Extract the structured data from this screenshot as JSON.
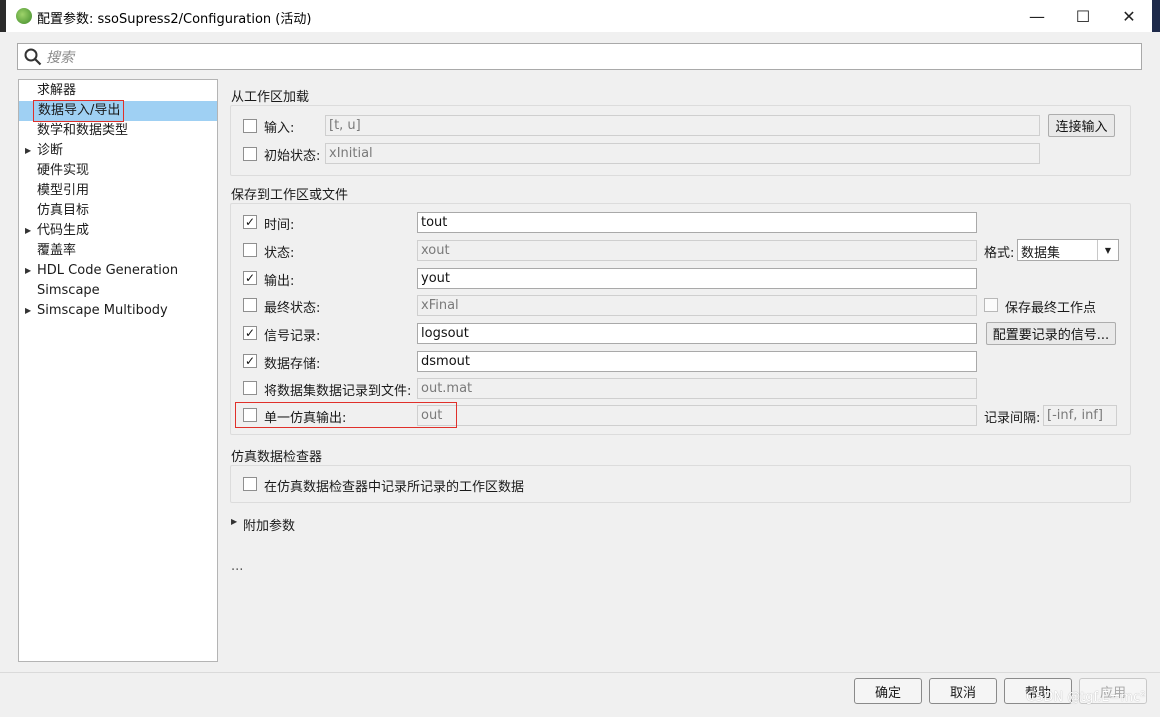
{
  "window": {
    "title": "配置参数: ssoSupress2/Configuration (活动)",
    "minimize_glyph": "—",
    "maximize_glyph": "☐",
    "close_glyph": "✕",
    "app_icon": "simulink-gear-icon"
  },
  "search": {
    "placeholder": "搜索",
    "icon": "search-icon"
  },
  "tree": {
    "items": [
      {
        "label": "求解器",
        "expandable": false
      },
      {
        "label": "数据导入/导出",
        "expandable": false,
        "selected": true
      },
      {
        "label": "数学和数据类型",
        "expandable": false
      },
      {
        "label": "诊断",
        "expandable": true
      },
      {
        "label": "硬件实现",
        "expandable": false
      },
      {
        "label": "模型引用",
        "expandable": false
      },
      {
        "label": "仿真目标",
        "expandable": false
      },
      {
        "label": "代码生成",
        "expandable": true
      },
      {
        "label": "覆盖率",
        "expandable": false
      },
      {
        "label": "HDL Code Generation",
        "expandable": true
      },
      {
        "label": "Simscape",
        "expandable": false
      },
      {
        "label": "Simscape Multibody",
        "expandable": true
      }
    ]
  },
  "load_section": {
    "title": "从工作区加载",
    "input": {
      "checked": false,
      "label": "输入:",
      "value": "[t, u]",
      "button": "连接输入"
    },
    "initial_state": {
      "checked": false,
      "label": "初始状态:",
      "value": "xInitial"
    }
  },
  "save_section": {
    "title": "保存到工作区或文件",
    "rows": [
      {
        "checked": true,
        "label": "时间:",
        "value": "tout",
        "enabled": true
      },
      {
        "checked": false,
        "label": "状态:",
        "value": "xout",
        "enabled": false
      },
      {
        "checked": true,
        "label": "输出:",
        "value": "yout",
        "enabled": true
      },
      {
        "checked": false,
        "label": "最终状态:",
        "value": "xFinal",
        "enabled": false
      },
      {
        "checked": true,
        "label": "信号记录:",
        "value": "logsout",
        "enabled": true
      },
      {
        "checked": true,
        "label": "数据存储:",
        "value": "dsmout",
        "enabled": true
      },
      {
        "checked": false,
        "label": "将数据集数据记录到文件:",
        "value": "out.mat",
        "enabled": false
      },
      {
        "checked": false,
        "label": "单一仿真输出:",
        "value": "out",
        "enabled": false
      }
    ],
    "format_label": "格式:",
    "format_value": "数据集",
    "save_final_op_label": "保存最终工作点",
    "save_final_op_checked": false,
    "config_signals_button": "配置要记录的信号...",
    "log_interval_label": "记录间隔:",
    "log_interval_value": "[-inf, inf]"
  },
  "sdi_section": {
    "title": "仿真数据检查器",
    "checkbox_label": "在仿真数据检查器中记录所记录的工作区数据",
    "checked": false
  },
  "additional_params": {
    "label": "附加参数"
  },
  "ellipsis": "...",
  "footer": {
    "ok": "确定",
    "cancel": "取消",
    "help": "帮助",
    "apply": "应用"
  },
  "watermark": "CSDN @tgf.E=mc²"
}
